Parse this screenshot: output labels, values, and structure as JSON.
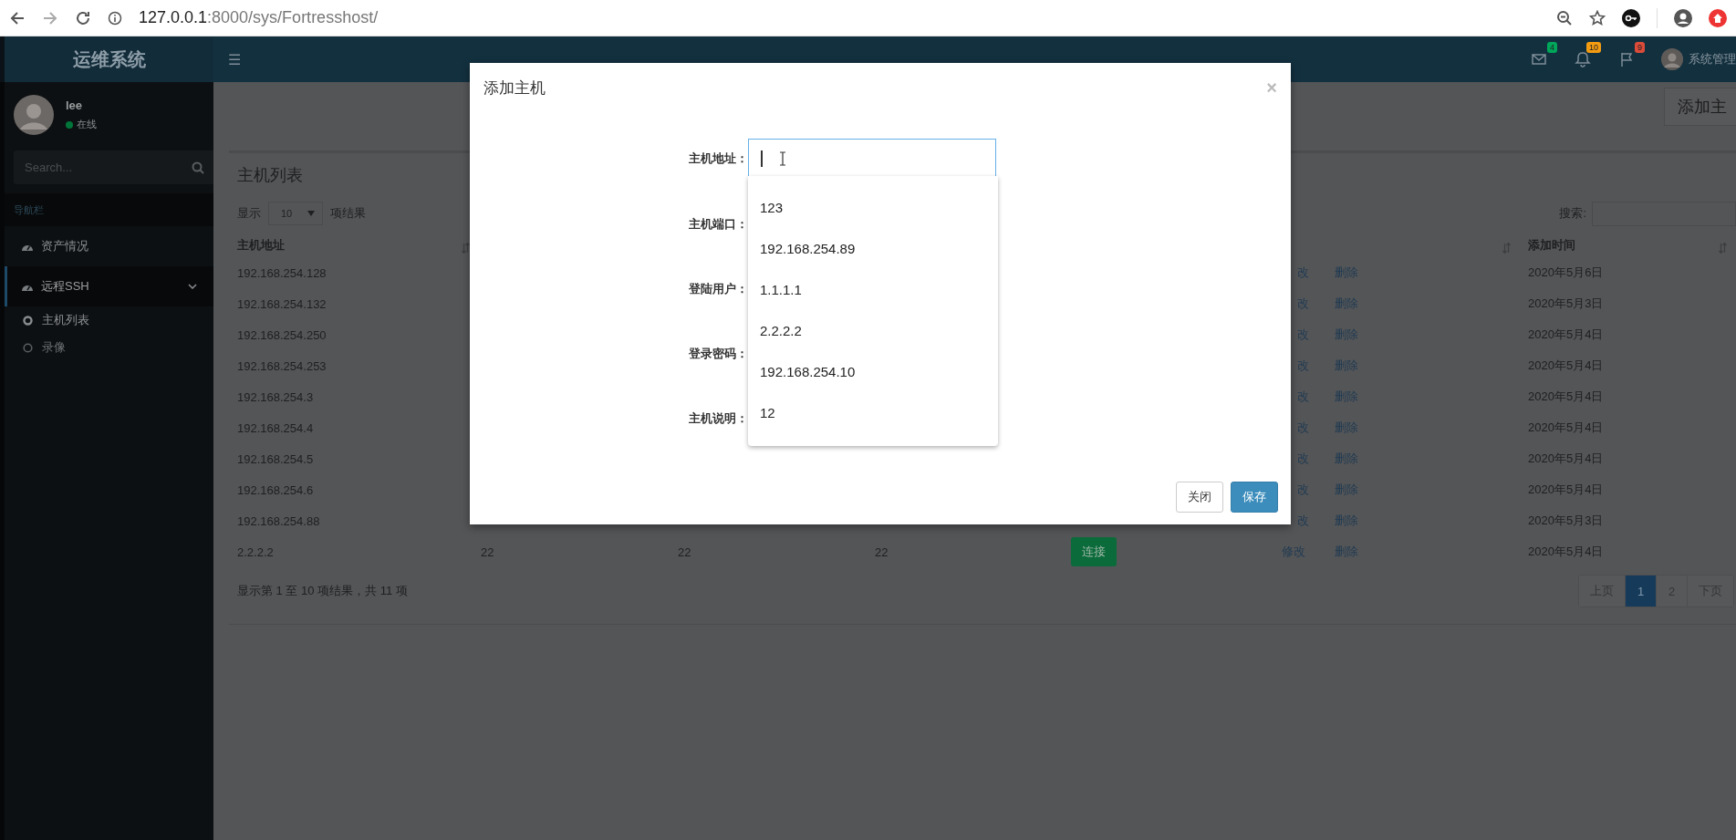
{
  "browser": {
    "url_host": "127.0.0.1",
    "url_rest": ":8000/sys/Fortresshost/"
  },
  "header": {
    "logo": "运维系统",
    "menu_glyph": "☰",
    "notifications": [
      {
        "kind": "mail",
        "count": "4",
        "color": "#00a65a"
      },
      {
        "kind": "bell",
        "count": "10",
        "color": "#f39c12"
      },
      {
        "kind": "flag",
        "count": "9",
        "color": "#dd4b39"
      }
    ],
    "user_name": "系统管理"
  },
  "sidebar": {
    "user": {
      "name": "lee",
      "status": "在线",
      "online": true
    },
    "search": {
      "placeholder": "Search..."
    },
    "section_label": "导航栏",
    "items": [
      {
        "label": "资产情况",
        "selected": false
      },
      {
        "label": "远程SSH",
        "selected": true,
        "expanded": true,
        "children": [
          {
            "label": "主机列表",
            "selected": true
          },
          {
            "label": "录像",
            "selected": false
          }
        ]
      }
    ]
  },
  "content": {
    "add_button": "添加主",
    "title": "主机列表",
    "length_menu": {
      "before": "显示",
      "value": "10",
      "after": "项结果"
    },
    "search_label": "搜索:",
    "columns": {
      "host": "主机地址",
      "added": "添加时间"
    },
    "rows": [
      {
        "host": "192.168.254.128",
        "edit": "改",
        "delete": "删除",
        "added": "2020年5月6日"
      },
      {
        "host": "192.168.254.132",
        "edit": "改",
        "delete": "删除",
        "added": "2020年5月3日"
      },
      {
        "host": "192.168.254.250",
        "edit": "改",
        "delete": "删除",
        "added": "2020年5月4日"
      },
      {
        "host": "192.168.254.253",
        "edit": "改",
        "delete": "删除",
        "added": "2020年5月4日"
      },
      {
        "host": "192.168.254.3",
        "edit": "改",
        "delete": "删除",
        "added": "2020年5月4日"
      },
      {
        "host": "192.168.254.4",
        "edit": "改",
        "delete": "删除",
        "added": "2020年5月4日"
      },
      {
        "host": "192.168.254.5",
        "edit": "改",
        "delete": "删除",
        "added": "2020年5月4日"
      },
      {
        "host": "192.168.254.6",
        "edit": "改",
        "delete": "删除",
        "added": "2020年5月4日"
      },
      {
        "host": "192.168.254.88",
        "edit": "改",
        "delete": "删除",
        "added": "2020年5月3日"
      },
      {
        "host": "2.2.2.2",
        "column_2": "22",
        "column_3": "22",
        "column_4": "22",
        "connect": "连接",
        "edit": "修改",
        "delete": "删除",
        "added": "2020年5月4日"
      }
    ],
    "info": "显示第 1 至 10 项结果，共 11 项",
    "pagination": [
      {
        "label": "上页",
        "selected": false
      },
      {
        "label": "1",
        "selected": true
      },
      {
        "label": "2",
        "selected": false
      },
      {
        "label": "下页",
        "selected": false
      }
    ]
  },
  "modal": {
    "title": "添加主机",
    "close": "×",
    "fields": [
      {
        "label": "主机地址：",
        "input": {
          "focused": true
        }
      },
      {
        "label": "主机端口："
      },
      {
        "label": "登陆用户："
      },
      {
        "label": "登录密码："
      },
      {
        "label": "主机说明："
      }
    ],
    "suggestions": [
      "123",
      "192.168.254.89",
      "1.1.1.1",
      "2.2.2.2",
      "192.168.254.10",
      "12"
    ],
    "buttons": [
      {
        "label": "关闭",
        "kind": "default"
      },
      {
        "label": "保存",
        "kind": "primary"
      }
    ]
  }
}
